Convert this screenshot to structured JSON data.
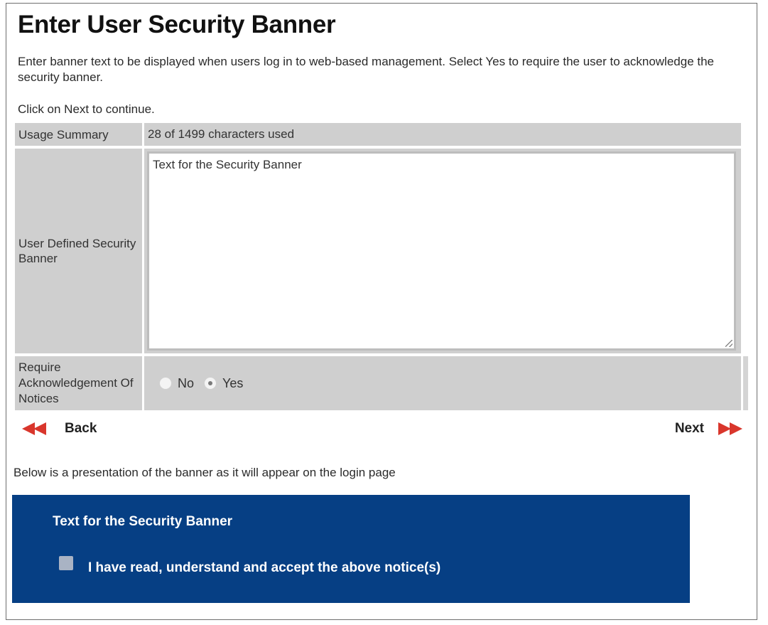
{
  "page": {
    "title": "Enter User Security Banner",
    "intro": "Enter banner text to be displayed when users log in to web-based management. Select Yes to require the user to acknowledge the security banner.",
    "click_next": "Click on Next to continue."
  },
  "form": {
    "usage_label": "Usage Summary",
    "usage_value": "28 of 1499 characters used",
    "banner_label": "User Defined Security Banner",
    "banner_value": "Text for the Security Banner",
    "ack_label": "Require Acknowledgement Of Notices",
    "ack_options": [
      "No",
      "Yes"
    ],
    "ack_selected": "Yes"
  },
  "nav": {
    "back_label": "Back",
    "next_label": "Next",
    "arrow_color": "#d9362c",
    "back_icon": "double-arrow-left-icon",
    "next_icon": "double-arrow-right-icon"
  },
  "preview": {
    "caption": "Below is a presentation of the banner as it will appear on the login page",
    "banner_text": "Text for the Security Banner",
    "ack_text": "I have read, understand and accept the above notice(s)",
    "ack_checked": false,
    "background_color": "#063f84"
  }
}
